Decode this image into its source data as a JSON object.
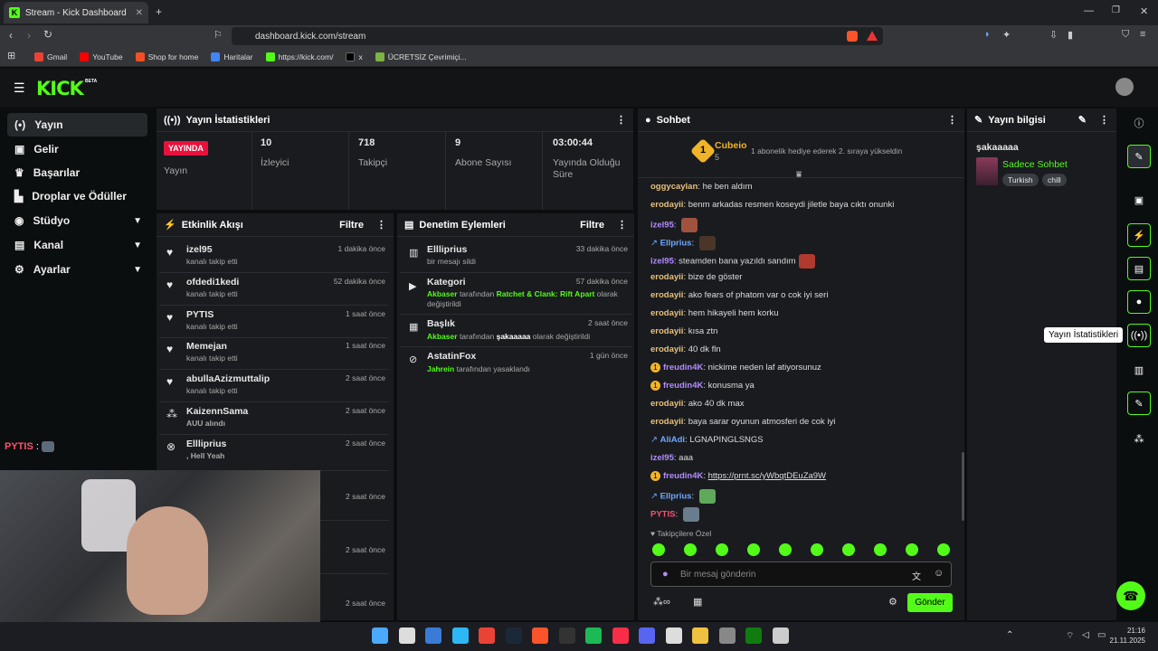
{
  "browser": {
    "tab_title": "Stream - Kick Dashboard",
    "url": "dashboard.kick.com/stream",
    "bookmarks": [
      "Gmail",
      "YouTube",
      "Shop for home",
      "Haritalar",
      "https://kick.com/",
      "x",
      "ÜCRETSİZ Çevrimiçi..."
    ]
  },
  "logo": "KICK",
  "logo_beta": "BETA",
  "sidebar": [
    {
      "label": "Yayın",
      "icon": "broadcast-icon"
    },
    {
      "label": "Gelir",
      "icon": "money-icon"
    },
    {
      "label": "Başarılar",
      "icon": "trophy-icon"
    },
    {
      "label": "Droplar ve Ödüller",
      "icon": "gift-icon"
    },
    {
      "label": "Stüdyo",
      "icon": "studio-icon"
    },
    {
      "label": "Kanal",
      "icon": "channel-icon"
    },
    {
      "label": "Ayarlar",
      "icon": "gear-icon"
    }
  ],
  "stats": {
    "title": "Yayın İstatistikleri",
    "live_badge": "YAYINDA",
    "live_label": "Yayın",
    "items": [
      {
        "value": "10",
        "label": "İzleyici"
      },
      {
        "value": "718",
        "label": "Takipçi"
      },
      {
        "value": "9",
        "label": "Abone Sayısı"
      },
      {
        "value": "03:00:44",
        "label": "Yayında Olduğu Süre"
      }
    ]
  },
  "activity": {
    "title": "Etkinlik Akışı",
    "filter": "Filtre",
    "events": [
      {
        "name": "izel95",
        "time": "1 dakika önce",
        "sub": "kanalı takip etti"
      },
      {
        "name": "ofdedi1kedi",
        "time": "52 dakika önce",
        "sub": "kanalı takip etti"
      },
      {
        "name": "PYTIS",
        "time": "1 saat önce",
        "sub": "kanalı takip etti"
      },
      {
        "name": "Memejan",
        "time": "1 saat önce",
        "sub": "kanalı takip etti"
      },
      {
        "name": "abullaAzizmuttalip",
        "time": "2 saat önce",
        "sub": "kanalı takip etti"
      },
      {
        "name": "KaizennSama",
        "time": "2 saat önce",
        "sub": "AUU alındı"
      },
      {
        "name": "Ellliprius",
        "time": "2 saat önce",
        "sub": ", Hell Yeah"
      },
      {
        "name": "",
        "time": "2 saat önce",
        "sub": ""
      },
      {
        "name": "",
        "time": "2 saat önce",
        "sub": ""
      },
      {
        "name": "",
        "time": "2 saat önce",
        "sub": ""
      }
    ]
  },
  "moderation": {
    "title": "Denetim Eylemleri",
    "filter": "Filtre",
    "items": [
      {
        "name": "Ellliprius",
        "time": "33 dakika önce",
        "actor": "",
        "text": "bir mesajı sildi",
        "extra": "",
        "tail": ""
      },
      {
        "name": "Kategori",
        "time": "57 dakika önce",
        "actor": "Akbaser",
        "text": "tarafından",
        "extra": "Ratchet & Clank: Rift Apart",
        "tail": "olarak değiştirildi"
      },
      {
        "name": "Başlık",
        "time": "2 saat önce",
        "actor": "Akbaser",
        "text": "tarafından",
        "extra": "şakaaaaa",
        "tail": "olarak değiştirildi"
      },
      {
        "name": "AstatinFox",
        "time": "1 gün önce",
        "actor": "Jahrein",
        "text": "tarafından yasaklandı",
        "extra": "",
        "tail": ""
      }
    ]
  },
  "chat": {
    "title": "Sohbet",
    "pinned_user": "Cubeio",
    "pinned_count": "5",
    "pinned_msg": "1 abonelik hediye ederek 2. sıraya yükseldin",
    "messages": [
      {
        "user": "oggycaylan",
        "color": "o",
        "text": "he ben aldım"
      },
      {
        "user": "erodayii",
        "color": "o",
        "text": "benm arkadas resmen koseydi jiletle baya cıktı onunki"
      },
      {
        "user": "izel95",
        "color": "p",
        "text": ""
      },
      {
        "user": "Ellprius",
        "color": "b",
        "text": ""
      },
      {
        "user": "izel95",
        "color": "p",
        "text": "steamden bana yazıldı sandım"
      },
      {
        "user": "erodayii",
        "color": "o",
        "text": "bize de göster"
      },
      {
        "user": "erodayii",
        "color": "o",
        "text": "ako fears of phatom var o cok iyi seri"
      },
      {
        "user": "erodayii",
        "color": "o",
        "text": "hem hikayeli hem korku"
      },
      {
        "user": "erodayii",
        "color": "o",
        "text": "kısa ztn"
      },
      {
        "user": "erodayii",
        "color": "o",
        "text": "40 dk fln"
      },
      {
        "user": "freudin4K",
        "color": "p",
        "text": "nickime neden laf atiyorsunuz"
      },
      {
        "user": "freudin4K",
        "color": "p",
        "text": "konusma ya"
      },
      {
        "user": "erodayii",
        "color": "o",
        "text": "ako 40 dk max"
      },
      {
        "user": "erodayii",
        "color": "o",
        "text": "baya sarar oyunun atmosferi de cok iyi"
      },
      {
        "user": "AliAdi",
        "color": "b",
        "text": "LGNAPINGLSNGS"
      },
      {
        "user": "izel95",
        "color": "p",
        "text": "aaa"
      },
      {
        "user": "freudin4K",
        "color": "p",
        "text": "https://prnt.sc/yWbqtDEuZa9W"
      },
      {
        "user": "Ellprius",
        "color": "b",
        "text": ""
      },
      {
        "user": "PYTIS",
        "color": "r",
        "text": ""
      }
    ],
    "emote_section": "Takipçilere Özel",
    "input_placeholder": "Bir mesaj gönderin",
    "send": "Gönder"
  },
  "info": {
    "title": "Yayın bilgisi",
    "stream_title": "şakaaaaa",
    "category": "Sadece Sohbet",
    "tags": [
      "Turkish",
      "chill"
    ]
  },
  "tooltip": "Yayın İstatistikleri",
  "overlay_user": "PYTIS",
  "clock": {
    "time": "21:16",
    "date": "21.11.2025"
  },
  "colors": {
    "accent": "#53fc18",
    "live": "#e9113c"
  }
}
